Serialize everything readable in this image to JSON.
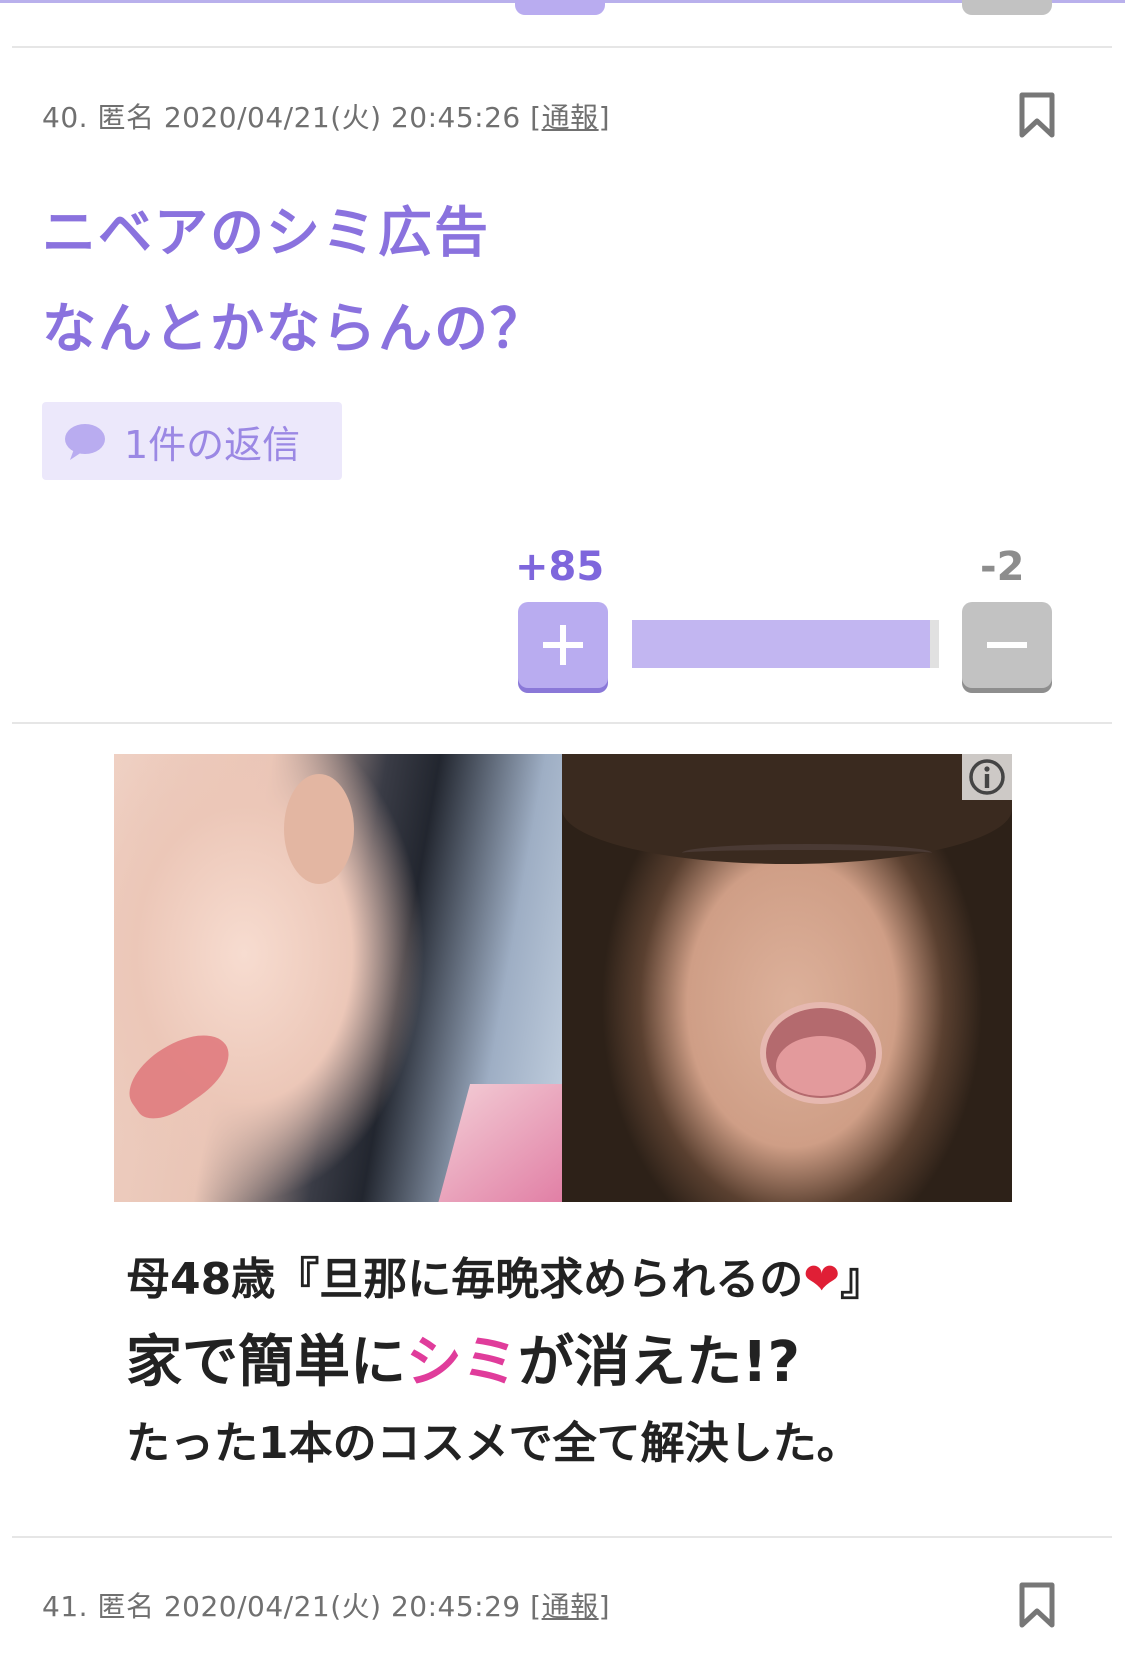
{
  "theme": {
    "accent": "#8a72de",
    "accent_light": "#b9acf0",
    "chip_bg": "#ece8fb",
    "minus_gray": "#c2c2c2",
    "highlight_pink": "#e03c9b"
  },
  "previous_comment": {
    "stub_icons": [
      "plus-button-stub",
      "minus-button-stub"
    ]
  },
  "comment_40": {
    "number": "40.",
    "author": "匿名",
    "datetime": "2020/04/21(火) 20:45:26",
    "report_open": "[",
    "report_label": "通報",
    "report_close": "]",
    "bookmark_icon": "bookmark-icon",
    "body_lines": [
      "ニベアのシミ広告",
      "なんとかならんの？"
    ],
    "reply_label": "1件の返信",
    "reply_icon": "speech-bubble-icon",
    "plus_count": "+85",
    "minus_count": "-2",
    "plus_icon": "plus-icon",
    "minus_icon": "minus-icon",
    "vote_ratio": 0.97
  },
  "ad": {
    "info_icon": "info-icon",
    "line1_pre": "母48歳『旦那に毎晩求められるの",
    "line1_heart": "❤",
    "line1_post": "』",
    "line2_pre": "家で簡単に",
    "line2_highlight": "シミ",
    "line2_post": "が消えた!?",
    "line3": "たった1本のコスメで全て解決した。"
  },
  "comment_41": {
    "number": "41.",
    "author": "匿名",
    "datetime": "2020/04/21(火) 20:45:29",
    "report_open": "[",
    "report_label": "通報",
    "report_close": "]",
    "bookmark_icon": "bookmark-icon"
  }
}
